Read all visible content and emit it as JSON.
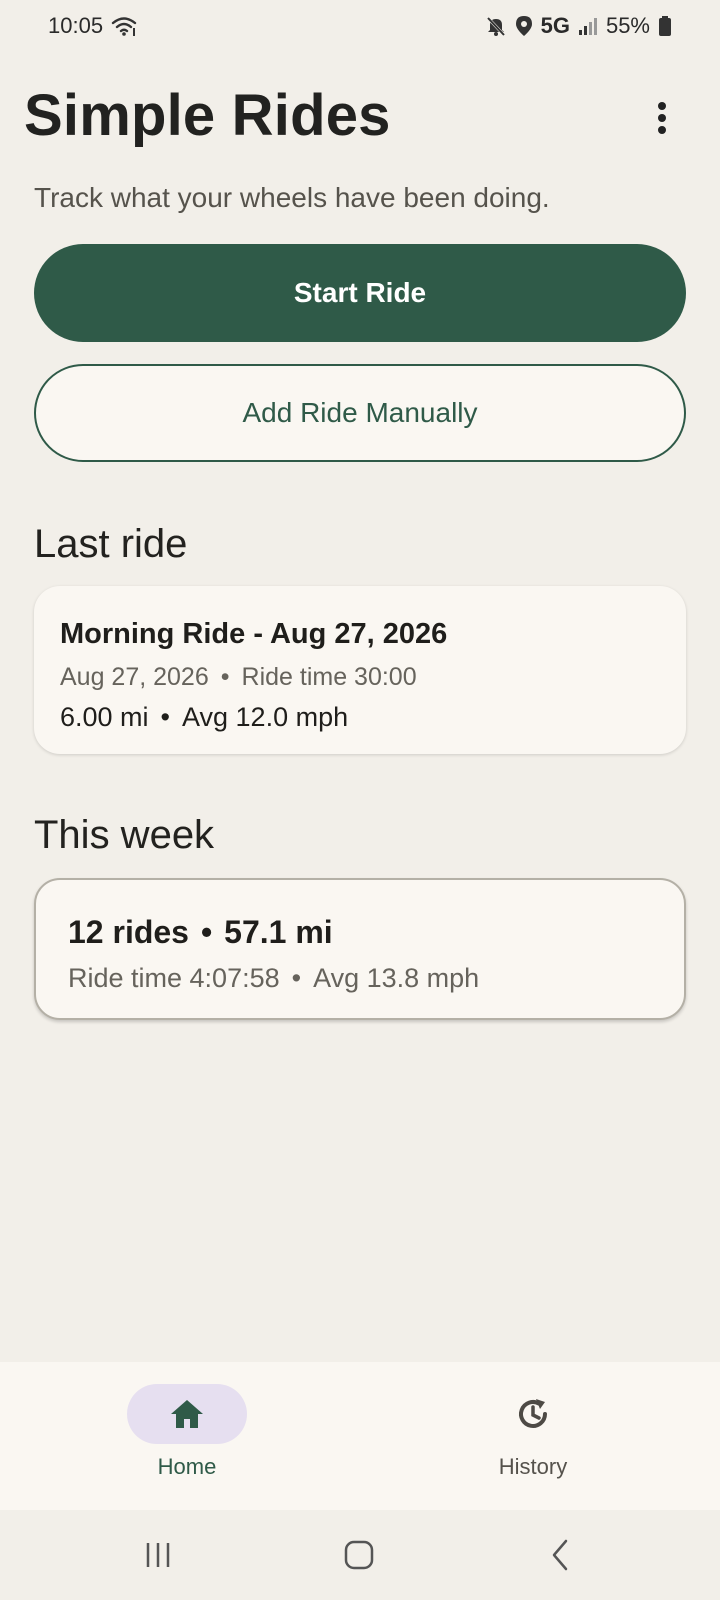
{
  "status_bar": {
    "time": "10:05",
    "network": "5G",
    "battery": "55%",
    "icons": [
      "wifi-icon",
      "mute-icon",
      "location-icon",
      "signal-icon",
      "battery-icon"
    ]
  },
  "app": {
    "title": "Simple Rides",
    "subtitle": "Track what your wheels have been doing.",
    "menu_icon": "more-vert-icon"
  },
  "actions": {
    "start_ride": "Start Ride",
    "add_manual": "Add Ride Manually"
  },
  "last_ride": {
    "heading": "Last ride",
    "name": "Morning Ride - Aug 27, 2026",
    "date": "Aug 27, 2026",
    "ride_time": "Ride time 30:00",
    "distance": "6.00 mi",
    "avg_speed": "Avg 12.0 mph"
  },
  "this_week": {
    "heading": "This week",
    "rides": "12 rides",
    "distance": "57.1 mi",
    "ride_time": "Ride time 4:07:58",
    "avg_speed": "Avg 13.8 mph"
  },
  "bottom_nav": {
    "items": [
      {
        "label": "Home",
        "icon": "home-icon",
        "selected": true
      },
      {
        "label": "History",
        "icon": "history-icon",
        "selected": false
      }
    ]
  },
  "system_nav": [
    "recents-icon",
    "home-circle-icon",
    "back-icon"
  ],
  "colors": {
    "background": "#f2efe9",
    "primary": "#2f5a48",
    "surface": "#faf7f2",
    "nav_indicator": "#e6dff0"
  }
}
